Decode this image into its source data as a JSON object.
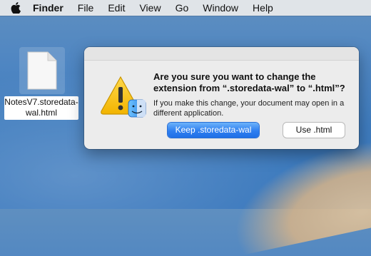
{
  "menubar": {
    "app_name": "Finder",
    "items": [
      "File",
      "Edit",
      "View",
      "Go",
      "Window",
      "Help"
    ]
  },
  "desktop": {
    "file_name": "NotesV7.storedata-wal.html"
  },
  "dialog": {
    "message": "Are you sure you want to change the extension from “.storedata-wal” to “.html”?",
    "info": "If you make this change, your document may open in a different application.",
    "primary_button": "Keep .storedata-wal",
    "secondary_button": "Use .html"
  },
  "colors": {
    "accent": "#2f7ff0",
    "warning": "#f4c21b"
  }
}
